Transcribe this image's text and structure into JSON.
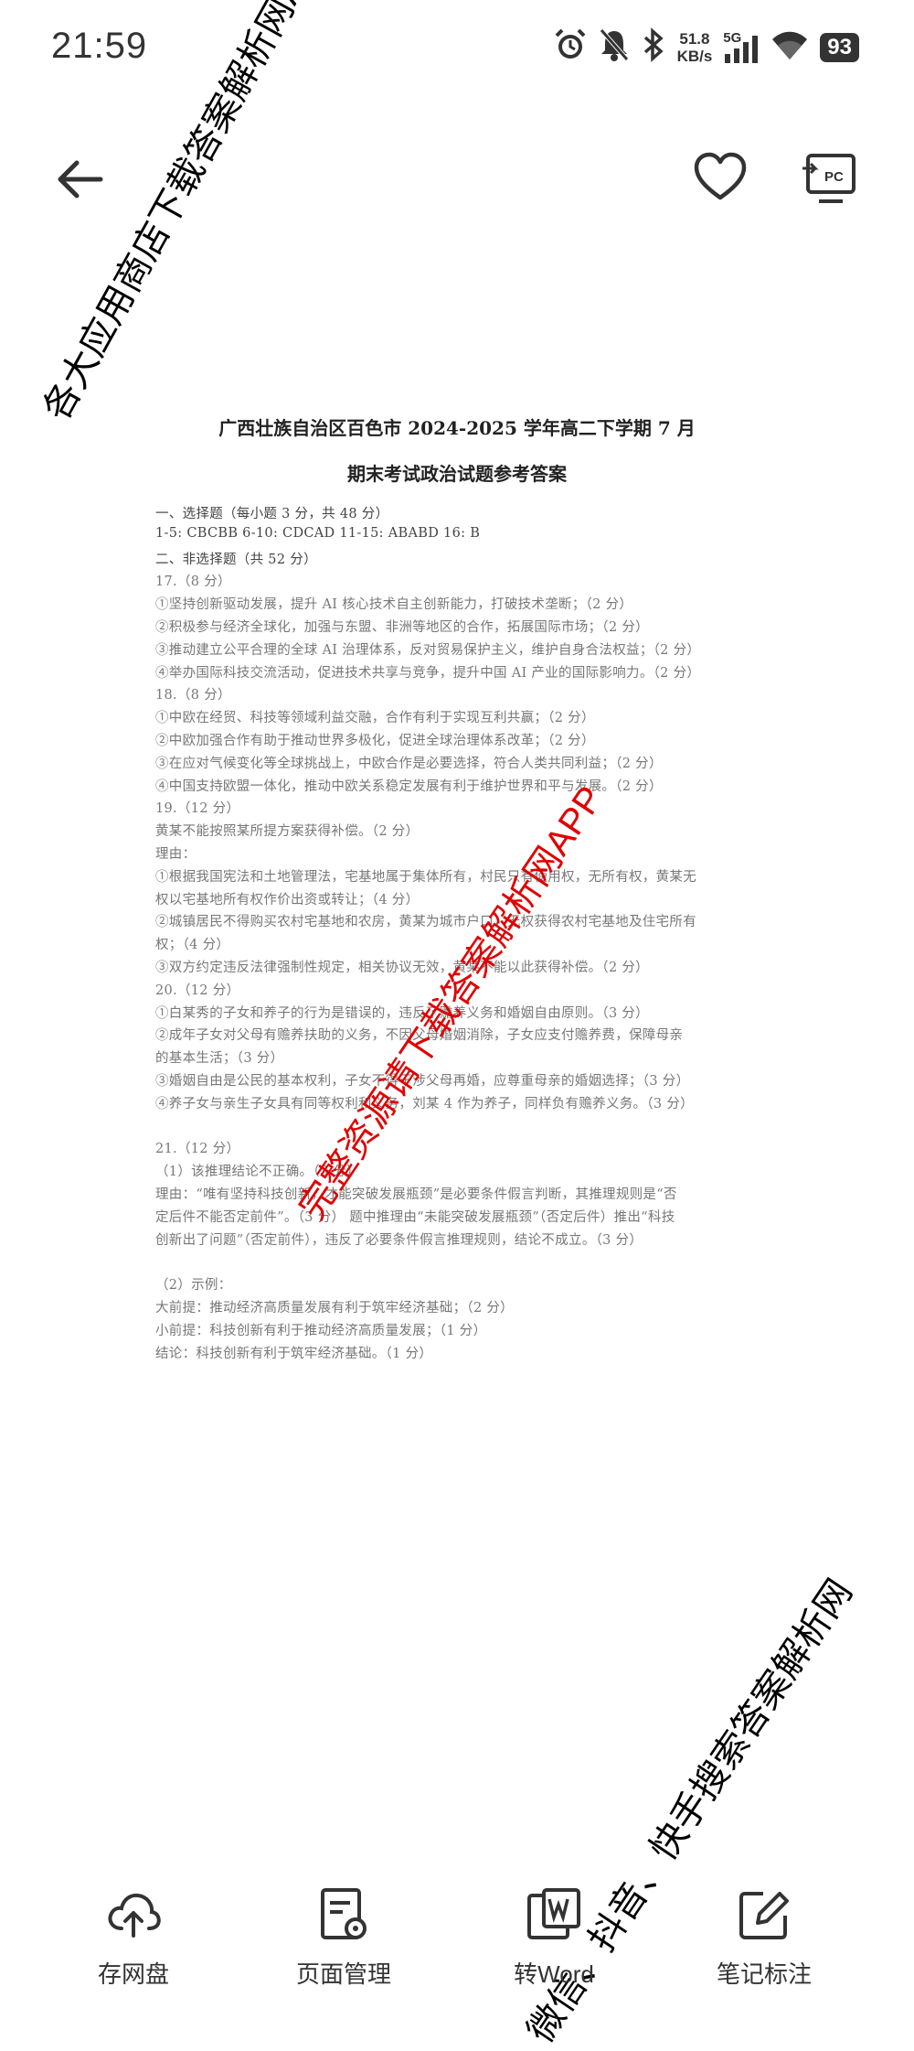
{
  "status_bar": {
    "time": "21:59",
    "net_speed_value": "51.8",
    "net_speed_unit": "KB/s",
    "network": "5G",
    "battery": "93",
    "icons": [
      "alarm-icon",
      "mute-bell-icon",
      "bluetooth-icon",
      "signal-icon",
      "wifi-icon"
    ]
  },
  "toolbar": {
    "back_icon": "back-arrow-icon",
    "favorite_icon": "heart-icon",
    "pc_icon": "pc-cast-icon",
    "pc_label": "PC"
  },
  "document": {
    "title_line1": "广西壮族自治区百色市 2024-2025 学年高二下学期 7 月",
    "title_line2": "期末考试政治试题参考答案",
    "lines": [
      "一、选择题（每小题 3 分，共 48 分）",
      "1-5: CBCBB  6-10: CDCAD  11-15: ABABD  16: B",
      "二、非选择题（共 52 分）",
      "17.（8 分）",
      "①坚持创新驱动发展，提升 AI 核心技术自主创新能力，打破技术垄断；（2 分）",
      "②积极参与经济全球化，加强与东盟、非洲等地区的合作，拓展国际市场；（2 分）",
      "③推动建立公平合理的全球 AI 治理体系，反对贸易保护主义，维护自身合法权益；（2 分）",
      "④举办国际科技交流活动，促进技术共享与竞争，提升中国 AI 产业的国际影响力。（2 分）",
      "18.（8 分）",
      "①中欧在经贸、科技等领域利益交融，合作有利于实现互利共赢；（2 分）",
      "②中欧加强合作有助于推动世界多极化，促进全球治理体系改革；（2 分）",
      "③在应对气候变化等全球挑战上，中欧合作是必要选择，符合人类共同利益；（2 分）",
      "④中国支持欧盟一体化，推动中欧关系稳定发展有利于维护世界和平与发展。（2 分）",
      "19.（12 分）",
      "黄某不能按照某所提方案获得补偿。（2 分）",
      "理由：",
      "①根据我国宪法和土地管理法，宅基地属于集体所有，村民只有使用权，无所有权，黄某无",
      "权以宅基地所有权作价出资或转让；（4 分）",
      "②城镇居民不得购买农村宅基地和农房，黄某为城市户口，无权获得农村宅基地及住宅所有",
      "权；（4 分）",
      "③双方约定违反法律强制性规定，相关协议无效，黄某不能以此获得补偿。（2 分）",
      "20.（12 分）",
      "①白某秀的子女和养子的行为是错误的，违反了赡养义务和婚姻自由原则。（3 分）",
      "②成年子女对父母有赡养扶助的义务，不因父母婚姻消除，子女应支付赡养费，保障母亲",
      "的基本生活；（3 分）",
      "③婚姻自由是公民的基本权利，子女不得干涉父母再婚，应尊重母亲的婚姻选择；（3 分）",
      "④养子女与亲生子女具有同等权利和义务，刘某 4 作为养子，同样负有赡养义务。（3 分）",
      "",
      "21.（12 分）",
      "（1）该推理结论不正确。（3 分）",
      "理由：“唯有坚持科技创新，才能突破发展瓶颈”是必要条件假言判断，其推理规则是“否",
      "定后件不能否定前件”。（3 分）  题中推理由“未能突破发展瓶颈”（否定后件）推出“科技",
      "创新出了问题”（否定前件），违反了必要条件假言推理规则，结论不成立。（3 分）",
      "",
      "（2）示例：",
      "大前提：推动经济高质量发展有利于筑牢经济基础；（2 分）",
      "小前提：科技创新有利于推动经济高质量发展；（1 分）",
      "结论：科技创新有利于筑牢经济基础。（1 分）"
    ]
  },
  "watermarks": {
    "top_left": "各大应用商店下载答案解析网APP",
    "center": "完整资源请下载答案解析网APP",
    "bottom_right": "微信、抖音、快手搜索答案解析网"
  },
  "bottom_nav": [
    {
      "label": "存网盘",
      "icon": "cloud-upload-icon"
    },
    {
      "label": "页面管理",
      "icon": "page-settings-icon"
    },
    {
      "label": "转Word",
      "icon": "word-convert-icon"
    },
    {
      "label": "笔记标注",
      "icon": "edit-note-icon"
    }
  ]
}
